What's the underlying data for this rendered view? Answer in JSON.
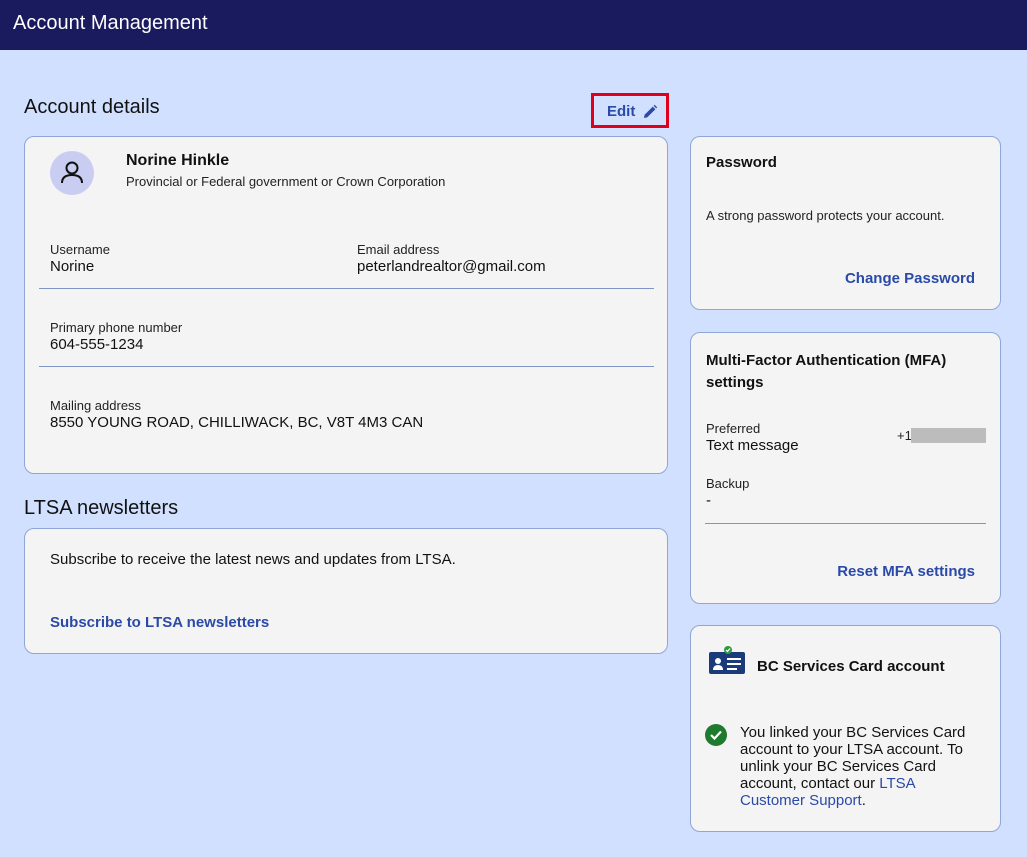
{
  "header": {
    "title": "Account Management"
  },
  "account": {
    "section_title": "Account details",
    "edit_label": "Edit",
    "name": "Norine Hinkle",
    "org_type": "Provincial or Federal government or Crown Corporation",
    "username_label": "Username",
    "username": "Norine",
    "email_label": "Email address",
    "email": "peterlandrealtor@gmail.com",
    "phone_label": "Primary phone number",
    "phone": "604-555-1234",
    "address_label": "Mailing address",
    "address": "8550 YOUNG ROAD, CHILLIWACK, BC, V8T 4M3 CAN"
  },
  "newsletters": {
    "section_title": "LTSA newsletters",
    "description": "Subscribe to receive the latest news and updates from LTSA.",
    "subscribe_label": "Subscribe to LTSA newsletters"
  },
  "password": {
    "title": "Password",
    "description": "A strong password protects your account.",
    "change_label": "Change Password"
  },
  "mfa": {
    "title_line1": "Multi-Factor Authentication (MFA)",
    "title_line2": "settings",
    "preferred_label": "Preferred",
    "preferred_value": "Text message",
    "preferred_phone_prefix": "+1",
    "backup_label": "Backup",
    "backup_value": "-",
    "reset_label": "Reset MFA settings"
  },
  "bcsc": {
    "title": "BC Services Card account",
    "line1": "You linked your BC Services Card",
    "line2": "account to your LTSA account. To",
    "line3": "unlink your BC Services Card",
    "line4_prefix": "account, contact our ",
    "link_part1": "LTSA",
    "link_part2": "Customer Support",
    "trailing_period": "."
  },
  "colors": {
    "header_bg": "#1a1a5e",
    "page_bg": "#d1e0ff",
    "link": "#2b4aa8",
    "highlight_border": "#e0001b",
    "success": "#1e7a2e"
  }
}
